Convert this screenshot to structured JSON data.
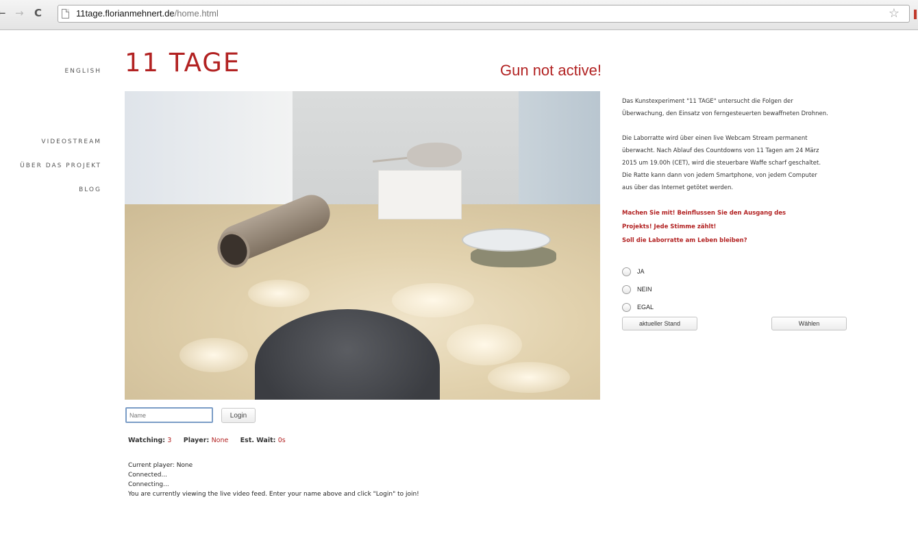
{
  "browser": {
    "back_icon": "←",
    "forward_icon": "→",
    "reload_icon": "C",
    "url_domain": "11tage.florianmehnert.de",
    "url_path": "/home.html",
    "bookmark_icon": "☆"
  },
  "header": {
    "language": "ENGLISH",
    "title": "11 TAGE",
    "gun_status": "Gun not active!"
  },
  "nav": {
    "items": [
      {
        "label": "VIDEOSTREAM"
      },
      {
        "label": "ÜBER DAS PROJEKT"
      },
      {
        "label": "BLOG"
      }
    ]
  },
  "login": {
    "name_placeholder": "Name",
    "login_label": "Login"
  },
  "stats": {
    "watching_label": "Watching:",
    "watching_value": "3",
    "player_label": "Player:",
    "player_value": "None",
    "wait_label": "Est. Wait:",
    "wait_value": "0s"
  },
  "log": [
    "Current player: None",
    "Connected...",
    "Connecting...",
    "You are currently viewing the live video feed. Enter your name above and click \"Login\" to join!"
  ],
  "info": {
    "para1_line1": "Das Kunstexperiment \"11 TAGE\" untersucht die Folgen der",
    "para1_line2": "Überwachung, den Einsatz von ferngesteuerten bewaffneten Drohnen.",
    "para2_lines": [
      "Die Laborratte wird über einen live Webcam Stream permanent",
      "überwacht. Nach Ablauf des Countdowns von 11 Tagen am 24 März",
      "2015 um 19.00h (CET), wird die steuerbare Waffe scharf geschaltet.",
      "Die Ratte kann dann von jedem Smartphone, von jedem Computer",
      "aus über das Internet getötet werden."
    ],
    "call_lines": [
      "Machen Sie mit! Beinflussen Sie den Ausgang des",
      "Projekts! Jede Stimme zählt!",
      "Soll die Laborratte am Leben bleiben?"
    ]
  },
  "poll": {
    "options": [
      "JA",
      "NEIN",
      "EGAL"
    ],
    "stand_button": "aktueller Stand",
    "vote_button": "Wählen"
  }
}
